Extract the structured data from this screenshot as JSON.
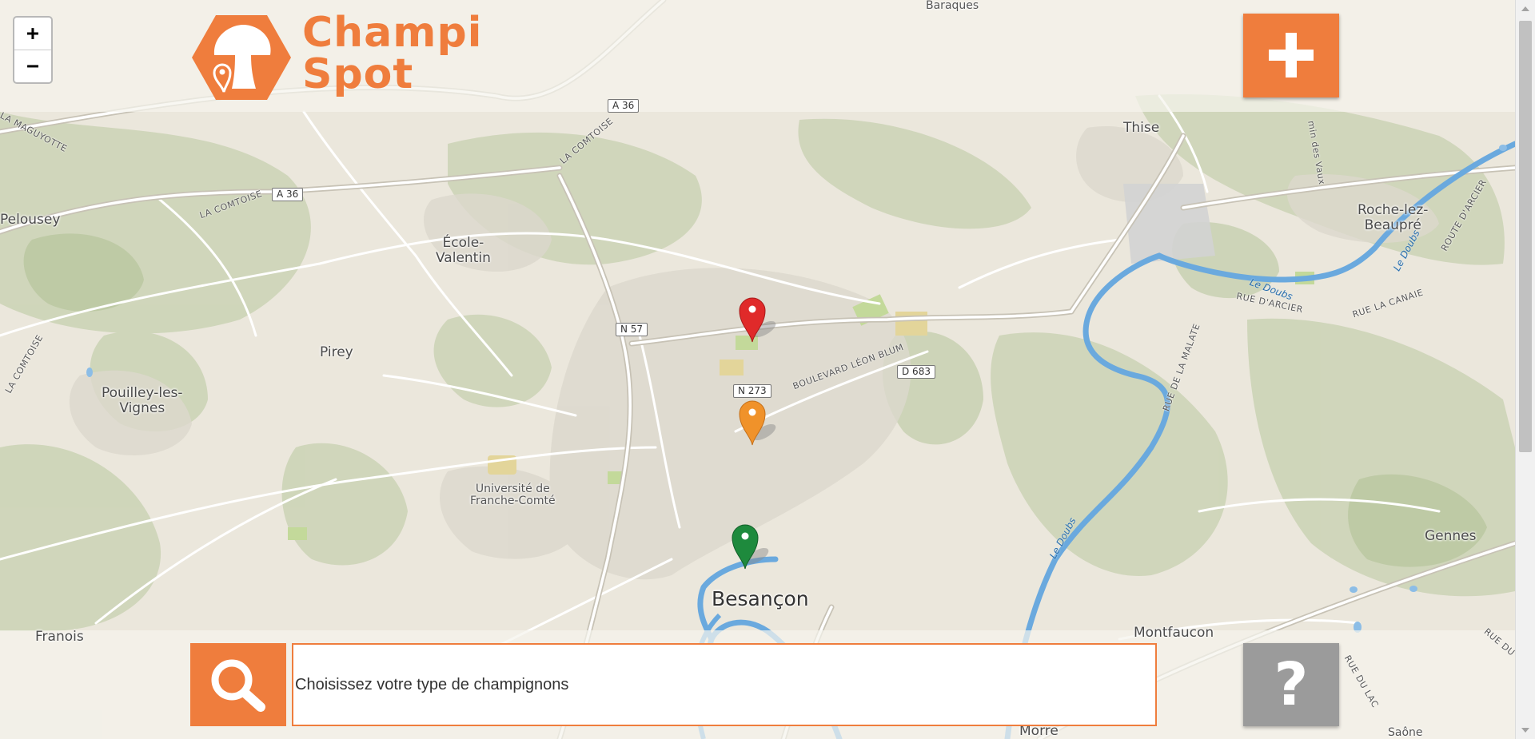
{
  "app": {
    "brand_line1": "Champi",
    "brand_line2": "Spot",
    "accent_color": "#ef7d3d",
    "help_color": "#9b9b9b"
  },
  "zoom": {
    "in_label": "+",
    "out_label": "−"
  },
  "add_button": {
    "icon": "plus-icon"
  },
  "search": {
    "icon": "magnifier-icon",
    "placeholder": "Choisissez votre type de champignons"
  },
  "help_button": {
    "label": "?"
  },
  "map": {
    "places": {
      "baraques": "Baraques",
      "thise": "Thise",
      "roche_1": "Roche-lez-",
      "roche_2": "Beaupré",
      "pelousey": "Pelousey",
      "ecole_1": "École-",
      "ecole_2": "Valentin",
      "pirey": "Pirey",
      "pouilley_1": "Pouilley-les-",
      "pouilley_2": "Vignes",
      "univ_1": "Université de",
      "univ_2": "Franche-Comté",
      "besancon": "Besançon",
      "gennes": "Gennes",
      "francis": "Franois",
      "montfaucon": "Montfaucon",
      "morre": "Morre",
      "saone": "Saône",
      "chemin": "min des Vaux"
    },
    "roads": {
      "a36_top": "A 36",
      "a36_left": "A 36",
      "n57": "N 57",
      "n273": "N 273",
      "d683": "D 683",
      "la_maguyotte": "LA MAGUYOTTE",
      "la_comtoise_1": "LA COMTOISE",
      "la_comtoise_2": "LA COMTOISE",
      "la_comtoise_3": "LA COMTOISE",
      "bd_leon_blum": "BOULEVARD LÉON BLUM",
      "rue_arcier": "RUE D'ARCIER",
      "rue_canaie": "RUE LA CANAIE",
      "route_arcier": "ROUTE D'ARCIER",
      "rue_malate": "RUE DE LA MALATE",
      "rue_du_lac": "RUE DU LAC",
      "rue_du": "RUE DU"
    },
    "rivers": {
      "doubs_1": "Le Doubs",
      "doubs_2": "Le Doubs",
      "doubs_3": "Le Doubs"
    },
    "markers": [
      {
        "color": "#e02a2a",
        "name": "red"
      },
      {
        "color": "#f0922a",
        "name": "orange"
      },
      {
        "color": "#1e8a3d",
        "name": "green"
      }
    ]
  }
}
